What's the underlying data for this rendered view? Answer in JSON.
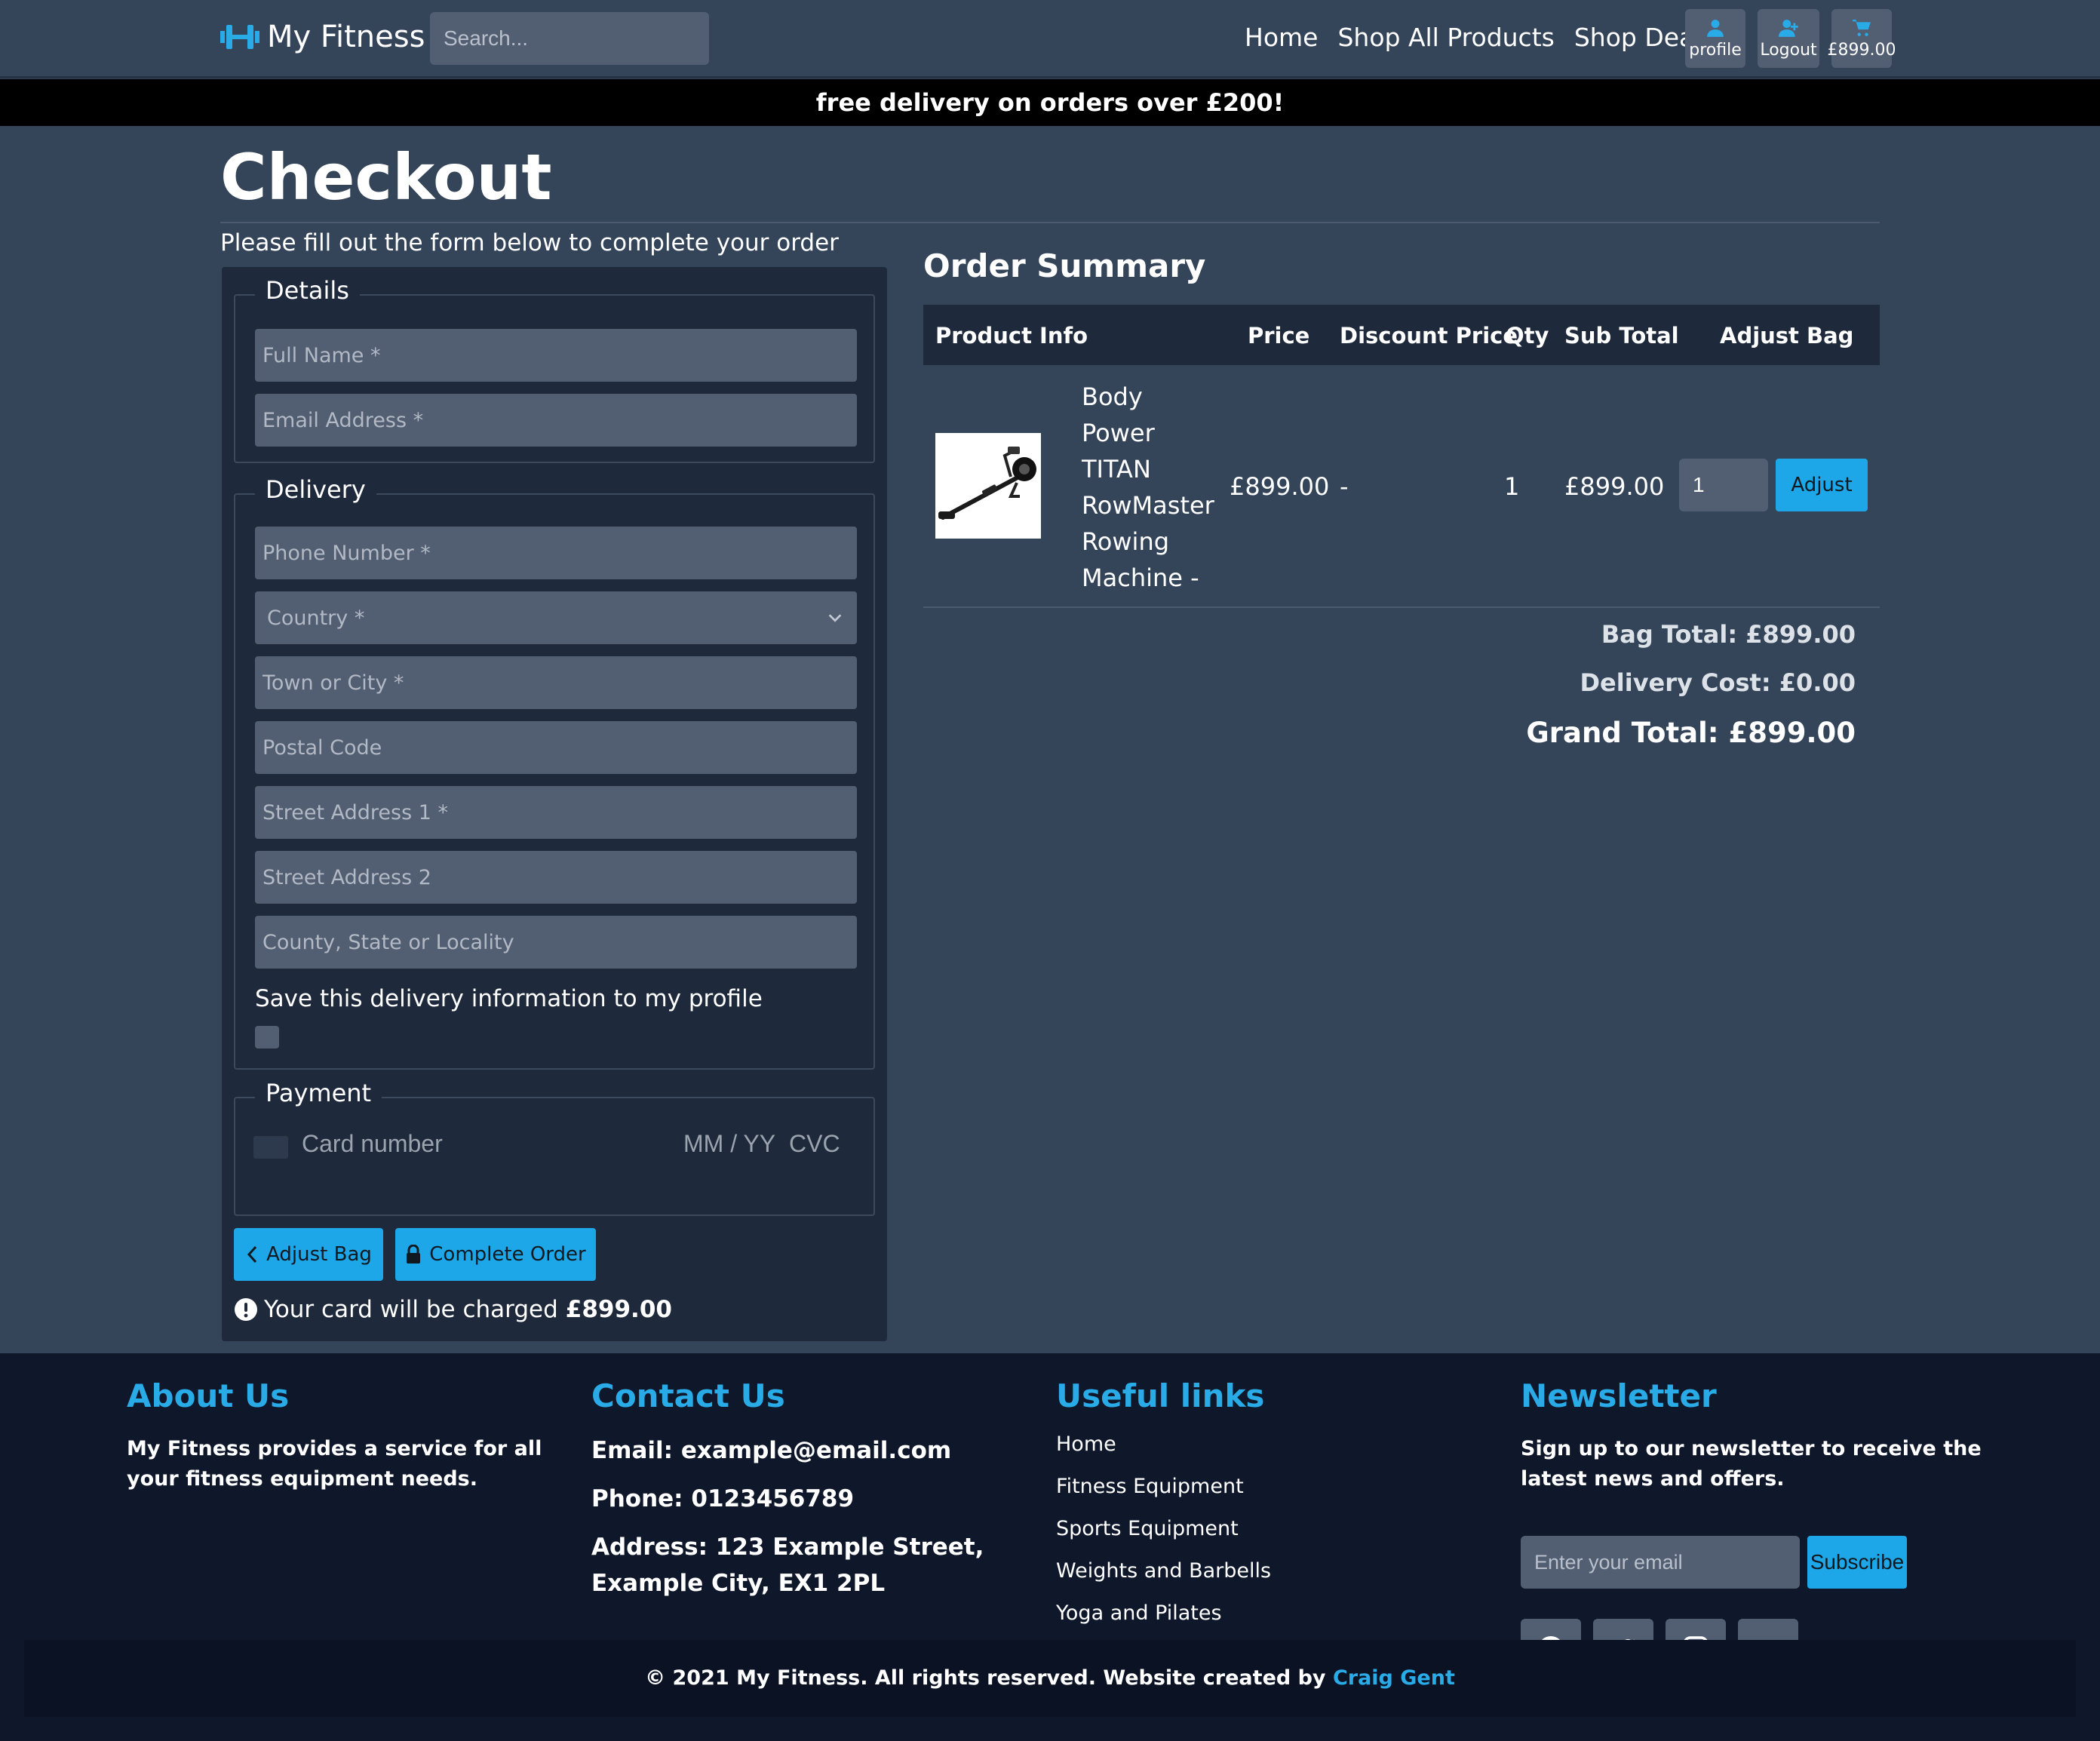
{
  "navbar": {
    "brand": "My Fitness",
    "search_placeholder": "Search...",
    "links": [
      "Home",
      "Shop All Products",
      "Shop Deals"
    ],
    "profile_label": "profile",
    "logout_label": "Logout",
    "bag_total": "£899.00"
  },
  "banner": "free delivery on orders over £200!",
  "page_title": "Checkout",
  "subtitle": "Please fill out the form below to complete your order",
  "form": {
    "details_legend": "Details",
    "full_name_placeholder": "Full Name *",
    "email_placeholder": "Email Address *",
    "delivery_legend": "Delivery",
    "phone_placeholder": "Phone Number *",
    "country_selected": "Country *",
    "town_placeholder": "Town or City *",
    "postcode_placeholder": "Postal Code",
    "street1_placeholder": "Street Address 1 *",
    "street2_placeholder": "Street Address 2",
    "county_placeholder": "County, State or Locality",
    "save_info_label": "Save this delivery information to my profile",
    "payment_legend": "Payment",
    "card_number_placeholder": "Card number",
    "card_expiry_placeholder": "MM / YY",
    "card_cvc_placeholder": "CVC",
    "adjust_bag_label": "Adjust Bag",
    "complete_order_label": "Complete Order",
    "charge_note": "Your card will be charged",
    "charge_amount": "£899.00"
  },
  "summary": {
    "title": "Order Summary",
    "columns": [
      "Product Info",
      "Price",
      "Discount Price",
      "Qty",
      "Sub Total",
      "Adjust Bag"
    ],
    "items": [
      {
        "name": "Body Power TITAN RowMaster Rowing Machine -",
        "price": "£899.00",
        "discount": "-",
        "qty": "1",
        "subtotal": "£899.00",
        "qty_input": "1",
        "adjust_label": "Adjust"
      }
    ],
    "bag_total": "Bag Total: £899.00",
    "delivery_cost": "Delivery Cost: £0.00",
    "grand_total": "Grand Total: £899.00"
  },
  "footer": {
    "about_title": "About Us",
    "about_text": "My Fitness provides a service for all your fitness equipment needs.",
    "contact_title": "Contact Us",
    "email": "Email: example@email.com",
    "phone": "Phone: 0123456789",
    "address": "Address: 123 Example Street, Example City, EX1 2PL",
    "links_title": "Useful links",
    "links": [
      "Home",
      "Fitness Equipment",
      "Sports Equipment",
      "Weights and Barbells",
      "Yoga and Pilates"
    ],
    "newsletter_title": "Newsletter",
    "newsletter_text": "Sign up to our newsletter to receive the latest news and offers.",
    "newsletter_placeholder": "Enter your email",
    "subscribe_label": "Subscribe",
    "social_icons": [
      "facebook-icon",
      "twitter-icon",
      "instagram-icon",
      "youtube-icon"
    ],
    "copyright": "© 2021 My Fitness. All rights reserved.  Website created by",
    "author": "Craig Gent"
  },
  "colors": {
    "background": "#344459",
    "panel": "#1e293b",
    "accent": "#1ea7e8",
    "footer": "#0f172a"
  }
}
